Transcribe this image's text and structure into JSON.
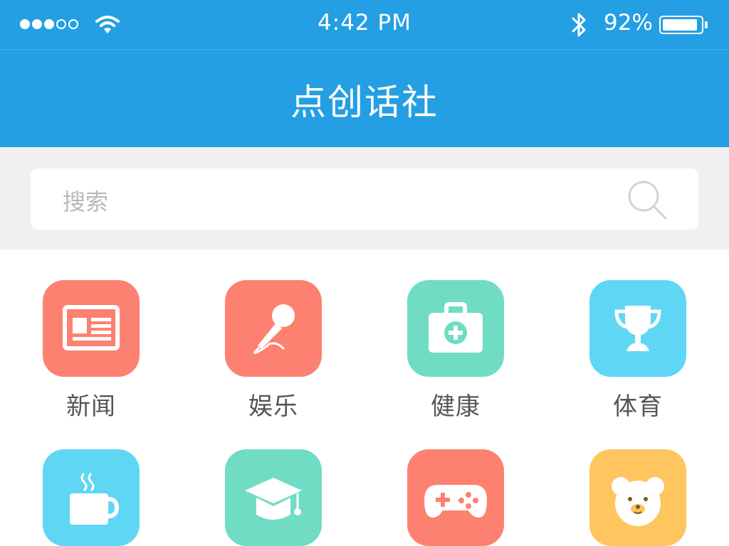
{
  "status_bar": {
    "signal_bars": 3,
    "signal_total": 5,
    "time": "4:42 PM",
    "battery_percent": "92%",
    "battery_level": 0.92
  },
  "nav": {
    "title": "点创话社"
  },
  "search": {
    "placeholder": "搜索"
  },
  "colors": {
    "primary": "#249fe3",
    "coral": "#fd8170",
    "mint": "#6fdcc3",
    "sky": "#5fd6f4",
    "amber": "#ffc55f"
  },
  "categories": [
    {
      "label": "新闻",
      "icon": "newspaper-icon",
      "color": "#fd8170"
    },
    {
      "label": "娱乐",
      "icon": "microphone-icon",
      "color": "#fd8170"
    },
    {
      "label": "健康",
      "icon": "medical-kit-icon",
      "color": "#6fdcc3"
    },
    {
      "label": "体育",
      "icon": "trophy-icon",
      "color": "#5fd6f4"
    },
    {
      "label": "",
      "icon": "coffee-cup-icon",
      "color": "#5fd6f4"
    },
    {
      "label": "",
      "icon": "graduation-cap-icon",
      "color": "#6fdcc3"
    },
    {
      "label": "",
      "icon": "gamepad-icon",
      "color": "#fd8170"
    },
    {
      "label": "",
      "icon": "teddy-bear-icon",
      "color": "#ffc55f"
    }
  ]
}
